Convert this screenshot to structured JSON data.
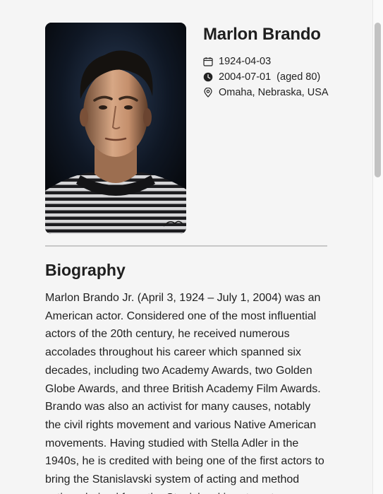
{
  "person": {
    "name": "Marlon Brando",
    "portrait_icon": "person-portrait-photo"
  },
  "facts": {
    "birth": {
      "icon": "calendar-icon",
      "date": "1924-04-03"
    },
    "death": {
      "icon": "clock-icon",
      "date": "2004-07-01",
      "age_note": "(aged 80)"
    },
    "birthplace": {
      "icon": "map-pin-icon",
      "place": "Omaha, Nebraska, USA"
    }
  },
  "biography": {
    "heading": "Biography",
    "text": "Marlon Brando Jr. (April 3, 1924 – July 1, 2004) was an American actor. Considered one of the most influential actors of the 20th century, he received numerous accolades throughout his career which spanned six decades, including two Academy Awards, two Golden Globe Awards, and three British Academy Film Awards. Brando was also an activist for many causes, notably the civil rights movement and various Native American movements. Having studied with Stella Adler in the 1940s, he is credited with being one of the first actors to bring the Stanislavski system of acting and method acting, derived from the Stanislavski system, to"
  },
  "colors": {
    "background": "#f5f5f5",
    "text": "#1f1f1f",
    "divider": "#c8c8c8",
    "scrollbar_thumb": "#c2c2c2"
  }
}
